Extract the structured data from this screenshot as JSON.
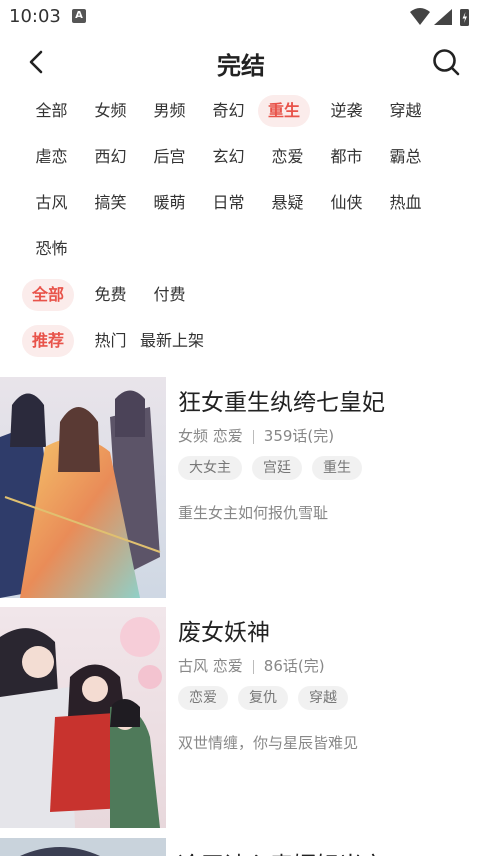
{
  "status": {
    "time": "10:03",
    "notif_glyph": "A"
  },
  "header": {
    "title": "完结"
  },
  "categories": [
    "全部",
    "女频",
    "男频",
    "奇幻",
    "重生",
    "逆袭",
    "穿越",
    "虐恋",
    "西幻",
    "后宫",
    "玄幻",
    "恋爱",
    "都市",
    "霸总",
    "古风",
    "搞笑",
    "暖萌",
    "日常",
    "悬疑",
    "仙侠",
    "热血",
    "恐怖"
  ],
  "categories_selected": "重生",
  "price": [
    "全部",
    "免费",
    "付费"
  ],
  "price_selected": "全部",
  "sort": [
    "推荐",
    "热门",
    "最新上架"
  ],
  "sort_selected": "推荐",
  "items": [
    {
      "title": "狂女重生纨绔七皇妃",
      "genre": "女频 恋爱",
      "chapters": "359话(完)",
      "tags": [
        "大女主",
        "宫廷",
        "重生"
      ],
      "desc": "重生女主如何报仇雪耻"
    },
    {
      "title": "废女妖神",
      "genre": "古风 恋爱",
      "chapters": "86话(完)",
      "tags": [
        "恋爱",
        "复仇",
        "穿越"
      ],
      "desc": "双世情缠，你与星辰皆难见"
    }
  ],
  "partial_title": "冷王读心毒婿妃当家",
  "colors": {
    "accent": "#e8534a",
    "chip_bg": "#fbeceb"
  }
}
